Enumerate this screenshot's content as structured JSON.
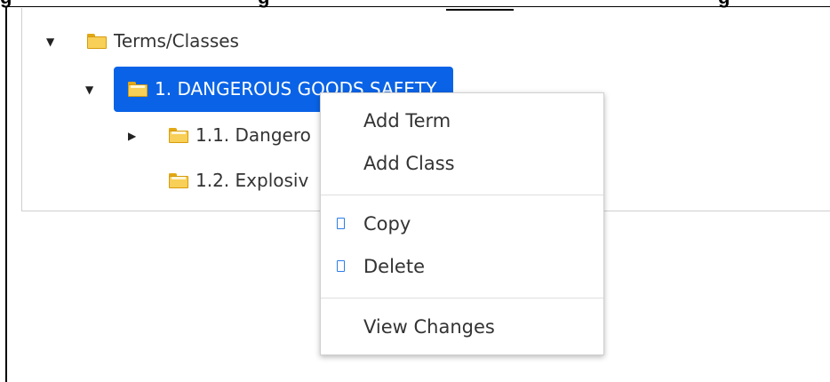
{
  "header_fragment": {
    "text_left": "g",
    "text_middle": "g",
    "text_underlined": "",
    "text_right": "g"
  },
  "tree": {
    "root": {
      "label": "Terms/Classes",
      "expanded": true,
      "caret": "▼"
    },
    "selected": {
      "label": "1. DANGEROUS GOODS SAFETY",
      "expanded": true,
      "caret": "▼"
    },
    "children": [
      {
        "label": "1.1. Dangero",
        "expanded": false,
        "caret": "▶"
      },
      {
        "label": "1.2. Explosiv",
        "caret": ""
      }
    ]
  },
  "context_menu": {
    "items": [
      {
        "label": "Add Term",
        "icon": ""
      },
      {
        "label": "Add Class",
        "icon": ""
      },
      {
        "label": "Copy",
        "icon": "copy-icon"
      },
      {
        "label": "Delete",
        "icon": "delete-icon"
      },
      {
        "label": "View Changes",
        "icon": ""
      }
    ]
  },
  "colors": {
    "selection": "#0a63e6",
    "folder": "#f8cf57",
    "icon_outline": "#2b7de9"
  }
}
